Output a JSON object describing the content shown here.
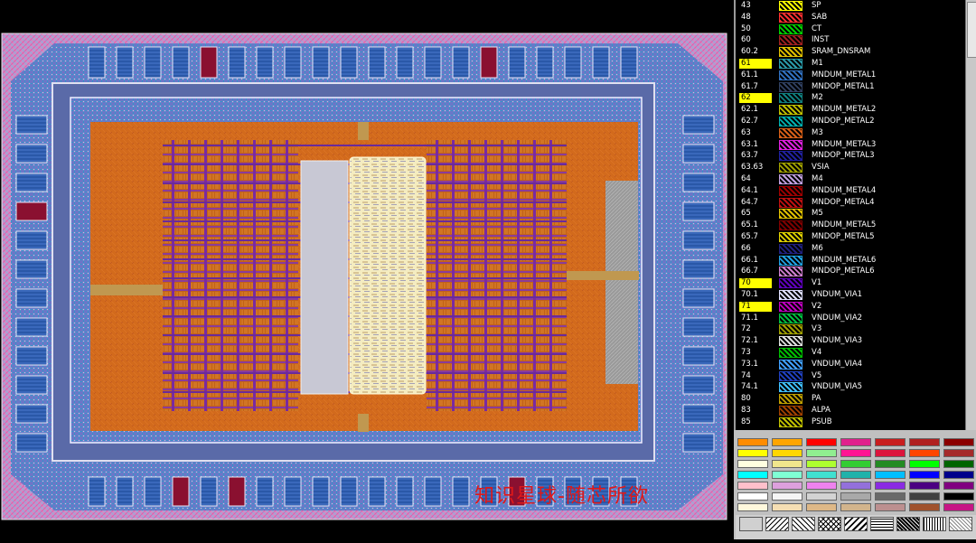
{
  "layout_view": {
    "watermark": "知识星球-随芯所欲"
  },
  "layers": [
    {
      "num": "43",
      "name": "SP",
      "color": "#ffff00",
      "hl": false
    },
    {
      "num": "48",
      "name": "SAB",
      "color": "#ff3030",
      "hl": false
    },
    {
      "num": "50",
      "name": "CT",
      "color": "#00d000",
      "hl": false
    },
    {
      "num": "60",
      "name": "INST",
      "color": "#a02020",
      "hl": false
    },
    {
      "num": "60.2",
      "name": "SRAM_DNSRAM",
      "color": "#e0c000",
      "hl": false
    },
    {
      "num": "61",
      "name": "M1",
      "color": "#2a9aa8",
      "hl": true
    },
    {
      "num": "61.1",
      "name": "MNDUM_METAL1",
      "color": "#3070c0",
      "hl": false
    },
    {
      "num": "61.7",
      "name": "MNDOP_METAL1",
      "color": "#304060",
      "hl": false
    },
    {
      "num": "62",
      "name": "M2",
      "color": "#108080",
      "hl": true
    },
    {
      "num": "62.1",
      "name": "MNDUM_METAL2",
      "color": "#c0c000",
      "hl": false
    },
    {
      "num": "62.7",
      "name": "MNDOP_METAL2",
      "color": "#00b0b0",
      "hl": false
    },
    {
      "num": "63",
      "name": "M3",
      "color": "#d86018",
      "hl": false
    },
    {
      "num": "63.1",
      "name": "MNDUM_METAL3",
      "color": "#e020e0",
      "hl": false
    },
    {
      "num": "63.7",
      "name": "MNDOP_METAL3",
      "color": "#2020a0",
      "hl": false
    },
    {
      "num": "63.63",
      "name": "VSIA",
      "color": "#a0a000",
      "hl": false
    },
    {
      "num": "64",
      "name": "M4",
      "color": "#c0a0e0",
      "hl": false
    },
    {
      "num": "64.1",
      "name": "MNDUM_METAL4",
      "color": "#a00000",
      "hl": false
    },
    {
      "num": "64.7",
      "name": "MNDOP_METAL4",
      "color": "#c01010",
      "hl": false
    },
    {
      "num": "65",
      "name": "M5",
      "color": "#e0c000",
      "hl": false
    },
    {
      "num": "65.1",
      "name": "MNDUM_METAL5",
      "color": "#800000",
      "hl": false
    },
    {
      "num": "65.7",
      "name": "MNDOP_METAL5",
      "color": "#e0d000",
      "hl": false
    },
    {
      "num": "66",
      "name": "M6",
      "color": "#202080",
      "hl": false
    },
    {
      "num": "66.1",
      "name": "MNDUM_METAL6",
      "color": "#20a0e0",
      "hl": false
    },
    {
      "num": "66.7",
      "name": "MNDOP_METAL6",
      "color": "#d080d0",
      "hl": false
    },
    {
      "num": "70",
      "name": "V1",
      "color": "#6000c0",
      "hl": true
    },
    {
      "num": "70.1",
      "name": "VNDUM_VIA1",
      "color": "#e0e0ff",
      "hl": false
    },
    {
      "num": "71",
      "name": "V2",
      "color": "#c000c0",
      "hl": true
    },
    {
      "num": "71.1",
      "name": "VNDUM_VIA2",
      "color": "#00c040",
      "hl": false
    },
    {
      "num": "72",
      "name": "V3",
      "color": "#a0a000",
      "hl": false
    },
    {
      "num": "72.1",
      "name": "VNDUM_VIA3",
      "color": "#e0e0e0",
      "hl": false
    },
    {
      "num": "73",
      "name": "V4",
      "color": "#00c000",
      "hl": false
    },
    {
      "num": "73.1",
      "name": "VNDUM_VIA4",
      "color": "#40a0ff",
      "hl": false
    },
    {
      "num": "74",
      "name": "V5",
      "color": "#2040c0",
      "hl": false
    },
    {
      "num": "74.1",
      "name": "VNDUM_VIA5",
      "color": "#40c0ff",
      "hl": false
    },
    {
      "num": "80",
      "name": "PA",
      "color": "#c0a000",
      "hl": false
    },
    {
      "num": "83",
      "name": "ALPA",
      "color": "#a04000",
      "hl": false
    },
    {
      "num": "85",
      "name": "PSUB",
      "color": "#c0c000",
      "hl": false
    }
  ],
  "color_palette": [
    [
      "#ff8c00",
      "#ffa500",
      "#ff0000",
      "#e0208c",
      "#c81e1e",
      "#b02020",
      "#8b0000"
    ],
    [
      "#ffff00",
      "#ffd700",
      "#90ee90",
      "#ff1493",
      "#dc143c",
      "#ff4500",
      "#a52a2a"
    ],
    [
      "#ffffe0",
      "#f0e68c",
      "#adff2f",
      "#32cd32",
      "#228b22",
      "#00ff00",
      "#006400"
    ],
    [
      "#00ffff",
      "#7fffd4",
      "#40e0d0",
      "#20b2aa",
      "#00bfff",
      "#0000ff",
      "#00008b"
    ],
    [
      "#ffc0cb",
      "#dda0dd",
      "#ee82ee",
      "#9370db",
      "#8a2be2",
      "#4b0082",
      "#800080"
    ],
    [
      "#ffffff",
      "#f5f5f5",
      "#d3d3d3",
      "#a9a9a9",
      "#696969",
      "#404040",
      "#000000"
    ],
    [
      "#fff8dc",
      "#f5deb3",
      "#deb887",
      "#d2b48c",
      "#bc8f8f",
      "#a0522d",
      "#c71585"
    ]
  ],
  "stipple_icons": [
    "stipple-blank-icon",
    "stipple-diag-icon",
    "stipple-diag2-icon",
    "stipple-cross-icon",
    "stipple-diag3-icon",
    "stipple-hatch-icon",
    "stipple-dense-icon",
    "stipple-fine-icon",
    "stipple-wave-icon"
  ]
}
